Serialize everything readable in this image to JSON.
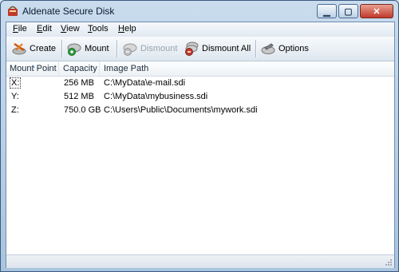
{
  "window": {
    "title": "Aldenate Secure Disk"
  },
  "menu": [
    "File",
    "Edit",
    "View",
    "Tools",
    "Help"
  ],
  "menu_accel": [
    "F",
    "E",
    "V",
    "T",
    "H"
  ],
  "menu_rest": [
    "ile",
    "dit",
    "iew",
    "ools",
    "elp"
  ],
  "toolbar": {
    "create": "Create",
    "mount": "Mount",
    "dismount": "Dismount",
    "dismount_all": "Dismount All",
    "options": "Options"
  },
  "columns": {
    "mount_point": "Mount Point",
    "capacity": "Capacity",
    "image_path": "Image Path"
  },
  "rows": [
    {
      "mount": "X:",
      "capacity": "256 MB",
      "path": "C:\\MyData\\e-mail.sdi"
    },
    {
      "mount": "Y:",
      "capacity": "512 MB",
      "path": "C:\\MyData\\mybusiness.sdi"
    },
    {
      "mount": "Z:",
      "capacity": "750.0 GB",
      "path": "C:\\Users\\Public\\Documents\\mywork.sdi"
    }
  ],
  "colors": {
    "accent": "#3a5a80",
    "disabled_text": "#9aa4ae"
  }
}
